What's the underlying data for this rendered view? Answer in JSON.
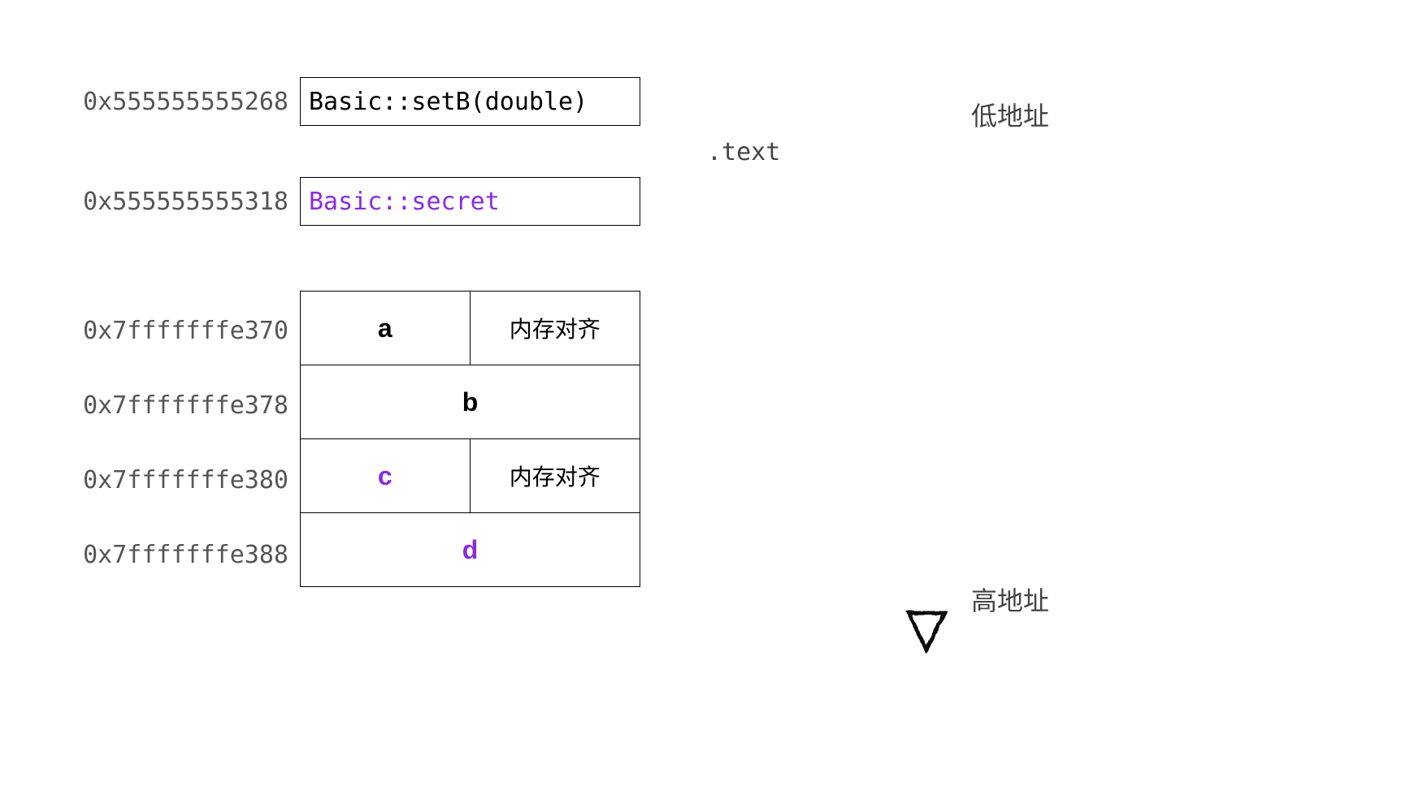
{
  "addresses": {
    "setB": "0x555555555268",
    "secret": "0x555555555318",
    "a": "0x7fffffffe370",
    "b": "0x7fffffffe378",
    "c": "0x7fffffffe380",
    "d": "0x7fffffffe388"
  },
  "functions": {
    "setB": "Basic::setB(double)",
    "secret": "Basic::secret"
  },
  "members": {
    "a": "a",
    "b": "b",
    "c": "c",
    "d": "d",
    "padding": "内存对齐"
  },
  "section": ".text",
  "arrow": {
    "low": "低地址",
    "high": "高地址"
  }
}
